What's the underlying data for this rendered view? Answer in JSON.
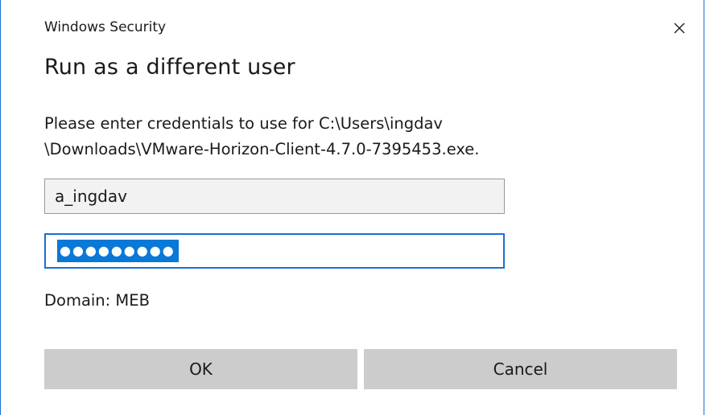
{
  "window": {
    "caption": "Windows Security",
    "close_icon": "close-icon"
  },
  "dialog": {
    "heading": "Run as a different user",
    "message_line1": "Please enter credentials to use for C:\\Users\\ingdav",
    "message_line2": "\\Downloads\\VMware-Horizon-Client-4.7.0-7395453.exe.",
    "username_value": "a_ingdav",
    "password_masked": "●●●●●●●●●",
    "domain_text": "Domain: MEB",
    "ok_label": "OK",
    "cancel_label": "Cancel"
  },
  "colors": {
    "accent": "#1b6fd6",
    "selection": "#0a78d7",
    "button_bg": "#cccccc",
    "readonly_field_bg": "#f2f2f2"
  }
}
